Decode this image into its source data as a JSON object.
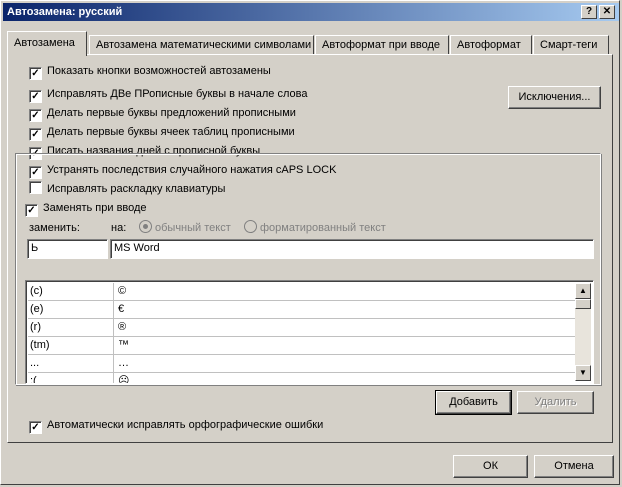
{
  "window": {
    "title": "Автозамена: русский",
    "help_btn": "?",
    "close_btn": "✕"
  },
  "tabs": [
    {
      "label": "Автозамена"
    },
    {
      "label": "Автозамена математическими символами"
    },
    {
      "label": "Автоформат при вводе"
    },
    {
      "label": "Автоформат"
    },
    {
      "label": "Смарт-теги"
    }
  ],
  "options": {
    "show_buttons": "Показать кнопки возможностей автозамены",
    "fix_two_caps": "Исправлять ДВе ПРописные буквы в начале слова",
    "capitalize_sentence": "Делать первые буквы предложений прописными",
    "capitalize_table": "Делать первые буквы ячеек таблиц прописными",
    "day_names": "Писать названия дней с прописной буквы",
    "caps_lock": "Устранять последствия случайного нажатия cAPS LOCK",
    "keyboard_layout": "Исправлять раскладку клавиатуры",
    "replace_as_type": "Заменять при вводе",
    "auto_spell": "Автоматически исправлять орфографические ошибки"
  },
  "check": "✓",
  "exceptions_btn": "Исключения...",
  "replace": {
    "replace_label": "заменить:",
    "with_label": "на:",
    "plain_text": "обычный текст",
    "formatted_text": "форматированный текст",
    "replace_value": "Ь",
    "with_value": "MS Word"
  },
  "list_rows": [
    {
      "from": "(c)",
      "to": "©"
    },
    {
      "from": "(e)",
      "to": "€"
    },
    {
      "from": "(r)",
      "to": "®"
    },
    {
      "from": "(tm)",
      "to": "™"
    },
    {
      "from": "...",
      "to": "…"
    },
    {
      "from": ":(",
      "to": "☹"
    },
    {
      "from": ":-(",
      "to": "☹"
    }
  ],
  "scroll": {
    "up": "▲",
    "down": "▼"
  },
  "buttons": {
    "add": "Добавить",
    "delete": "Удалить",
    "ok": "ОК",
    "cancel": "Отмена"
  }
}
